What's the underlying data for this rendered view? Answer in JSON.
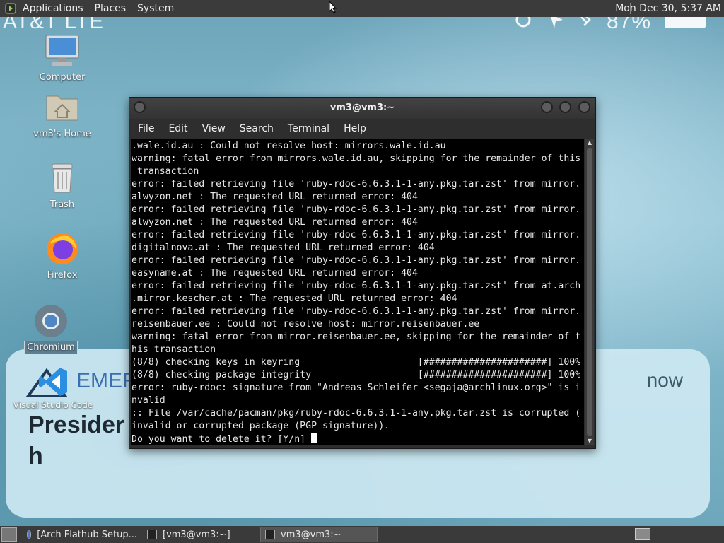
{
  "top_panel": {
    "menus": [
      "Applications",
      "Places",
      "System"
    ],
    "clock": "Mon Dec 30,  5:37 AM"
  },
  "wallpaper": {
    "carrier": "AT&T   LTE",
    "battery": "87%",
    "card_brand": "EMER",
    "card_time": "now",
    "card_headline_1": "Presider",
    "card_headline_2": "h"
  },
  "desktop_icons": [
    {
      "label": "Computer",
      "icon": "computer-icon"
    },
    {
      "label": "vm3's Home",
      "icon": "home-folder-icon"
    },
    {
      "label": "Trash",
      "icon": "trash-icon"
    },
    {
      "label": "Firefox",
      "icon": "firefox-icon"
    },
    {
      "label": "Chromium",
      "icon": "chromium-icon"
    },
    {
      "label": "Visual Studio Code",
      "icon": "vscode-icon"
    }
  ],
  "terminal": {
    "title": "vm3@vm3:~",
    "menu": [
      "File",
      "Edit",
      "View",
      "Search",
      "Terminal",
      "Help"
    ],
    "lines": [
      ".wale.id.au : Could not resolve host: mirrors.wale.id.au",
      "warning: fatal error from mirrors.wale.id.au, skipping for the remainder of this",
      " transaction",
      "error: failed retrieving file 'ruby-rdoc-6.6.3.1-1-any.pkg.tar.zst' from mirror.",
      "alwyzon.net : The requested URL returned error: 404",
      "error: failed retrieving file 'ruby-rdoc-6.6.3.1-1-any.pkg.tar.zst' from mirror.",
      "alwyzon.net : The requested URL returned error: 404",
      "error: failed retrieving file 'ruby-rdoc-6.6.3.1-1-any.pkg.tar.zst' from mirror.",
      "digitalnova.at : The requested URL returned error: 404",
      "error: failed retrieving file 'ruby-rdoc-6.6.3.1-1-any.pkg.tar.zst' from mirror.",
      "easyname.at : The requested URL returned error: 404",
      "error: failed retrieving file 'ruby-rdoc-6.6.3.1-1-any.pkg.tar.zst' from at.arch",
      ".mirror.kescher.at : The requested URL returned error: 404",
      "error: failed retrieving file 'ruby-rdoc-6.6.3.1-1-any.pkg.tar.zst' from mirror.",
      "reisenbauer.ee : Could not resolve host: mirror.reisenbauer.ee",
      "warning: fatal error from mirror.reisenbauer.ee, skipping for the remainder of t",
      "his transaction",
      "(8/8) checking keys in keyring                     [######################] 100%",
      "(8/8) checking package integrity                   [######################] 100%",
      "error: ruby-rdoc: signature from \"Andreas Schleifer <segaja@archlinux.org>\" is i",
      "nvalid",
      ":: File /var/cache/pacman/pkg/ruby-rdoc-6.6.3.1-1-any.pkg.tar.zst is corrupted (",
      "invalid or corrupted package (PGP signature))."
    ],
    "prompt": "Do you want to delete it? [Y/n] "
  },
  "taskbar": {
    "tasks": [
      "[Arch Flathub Setup...",
      "[vm3@vm3:~]",
      "vm3@vm3:~"
    ]
  }
}
